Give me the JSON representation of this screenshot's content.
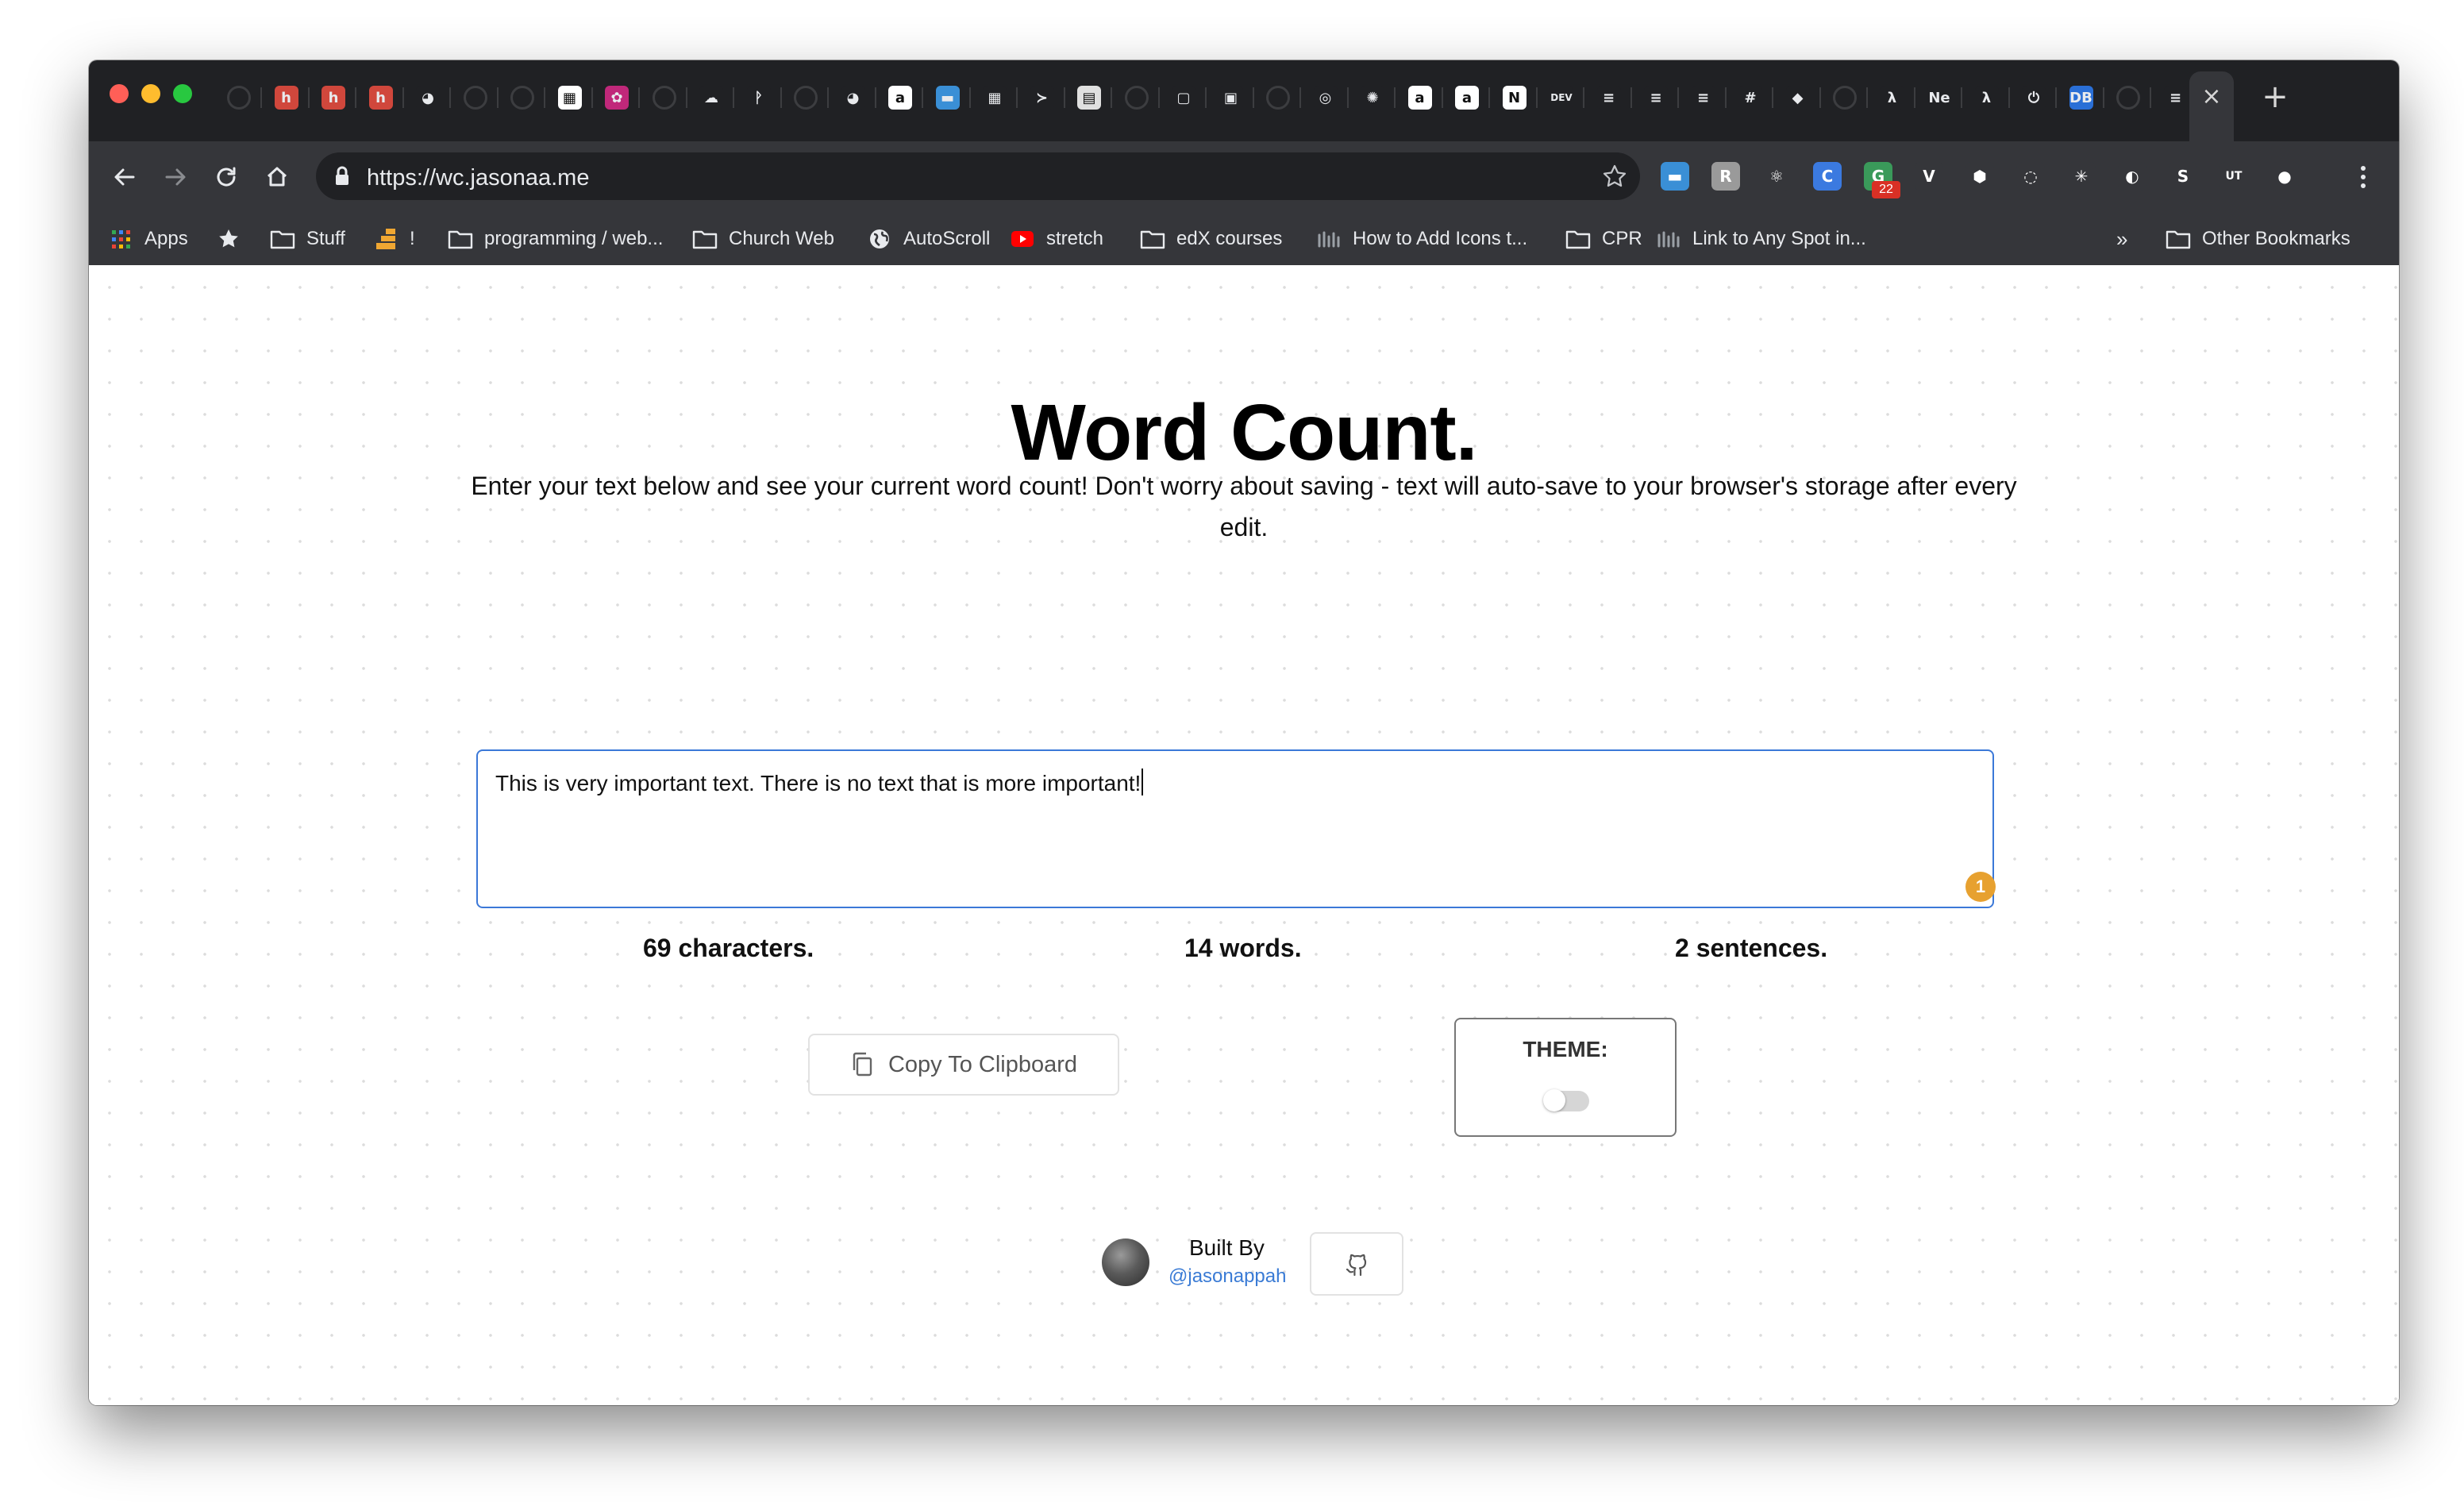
{
  "browser": {
    "url": "https://wc.jasonaa.me",
    "tab_favicons": [
      {
        "name": "github-icon",
        "glyph": "",
        "bg": "#202124"
      },
      {
        "name": "h-icon",
        "glyph": "h",
        "bg": "#d0473c"
      },
      {
        "name": "h-icon",
        "glyph": "h",
        "bg": "#d0473c"
      },
      {
        "name": "h-icon",
        "glyph": "h",
        "bg": "#d0473c"
      },
      {
        "name": "globe-icon",
        "glyph": "◕",
        "bg": "#202124"
      },
      {
        "name": "github-icon",
        "glyph": "",
        "bg": "#202124"
      },
      {
        "name": "github-icon",
        "glyph": "",
        "bg": "#202124"
      },
      {
        "name": "qr-icon",
        "glyph": "▦",
        "bg": "#ffffff"
      },
      {
        "name": "gear-pink-icon",
        "glyph": "✿",
        "bg": "#c0287a"
      },
      {
        "name": "github-icon",
        "glyph": "",
        "bg": "#202124"
      },
      {
        "name": "cloudflare-icon",
        "glyph": "☁",
        "bg": "#202124"
      },
      {
        "name": "leaf-icon",
        "glyph": "ᚹ",
        "bg": "#202124"
      },
      {
        "name": "github-icon",
        "glyph": "",
        "bg": "#202124"
      },
      {
        "name": "globe-icon",
        "glyph": "◕",
        "bg": "#202124"
      },
      {
        "name": "amazon-icon",
        "glyph": "a",
        "bg": "#ffffff"
      },
      {
        "name": "window-icon",
        "glyph": "▬",
        "bg": "#3a8fd6"
      },
      {
        "name": "microsoft-icon",
        "glyph": "▦",
        "bg": "#202124"
      },
      {
        "name": "vscode-icon",
        "glyph": "≻",
        "bg": "#202124"
      },
      {
        "name": "notes-icon",
        "glyph": "▤",
        "bg": "#e0e0e0"
      },
      {
        "name": "github-icon",
        "glyph": "",
        "bg": "#202124"
      },
      {
        "name": "square-icon",
        "glyph": "▢",
        "bg": "#202124"
      },
      {
        "name": "chip-icon",
        "glyph": "▣",
        "bg": "#202124"
      },
      {
        "name": "github-icon",
        "glyph": "",
        "bg": "#202124"
      },
      {
        "name": "circle-check-icon",
        "glyph": "◎",
        "bg": "#202124"
      },
      {
        "name": "openai-icon",
        "glyph": "✺",
        "bg": "#202124"
      },
      {
        "name": "amazon-icon",
        "glyph": "a",
        "bg": "#ffffff"
      },
      {
        "name": "amazon-icon",
        "glyph": "a",
        "bg": "#ffffff"
      },
      {
        "name": "notion-icon",
        "glyph": "N",
        "bg": "#ffffff"
      },
      {
        "name": "dev-icon",
        "glyph": "DEV",
        "bg": "#202124"
      },
      {
        "name": "stackoverflow-icon",
        "glyph": "≡",
        "bg": "#202124"
      },
      {
        "name": "stackoverflow-icon",
        "glyph": "≡",
        "bg": "#202124"
      },
      {
        "name": "stackoverflow-icon",
        "glyph": "≡",
        "bg": "#202124"
      },
      {
        "name": "slack-icon",
        "glyph": "#",
        "bg": "#202124"
      },
      {
        "name": "git-icon",
        "glyph": "◆",
        "bg": "#202124"
      },
      {
        "name": "github-icon",
        "glyph": "",
        "bg": "#202124"
      },
      {
        "name": "lambda-icon",
        "glyph": "λ",
        "bg": "#202124"
      },
      {
        "name": "ne-icon",
        "glyph": "Ne",
        "bg": "#202124"
      },
      {
        "name": "lambda-icon",
        "glyph": "λ",
        "bg": "#202124"
      },
      {
        "name": "power-icon",
        "glyph": "⏻",
        "bg": "#202124"
      },
      {
        "name": "dams-icon",
        "glyph": "DB",
        "bg": "#2a6fd6"
      },
      {
        "name": "github-icon",
        "glyph": "",
        "bg": "#202124"
      },
      {
        "name": "stackoverflow-icon",
        "glyph": "≡",
        "bg": "#202124"
      }
    ],
    "extensions": [
      {
        "name": "window-icon",
        "glyph": "▬",
        "bg": "#3a8fd6"
      },
      {
        "name": "r-icon",
        "glyph": "R",
        "bg": "#9a9a9a"
      },
      {
        "name": "react-icon",
        "glyph": "⚛",
        "bg": "#35363a"
      },
      {
        "name": "c-icon",
        "glyph": "C",
        "bg": "#3b7ae0"
      },
      {
        "name": "g-icon",
        "glyph": "G",
        "bg": "#3a9a5a",
        "badge": "22"
      },
      {
        "name": "vue-icon",
        "glyph": "V",
        "bg": "#35363a"
      },
      {
        "name": "cube-icon",
        "glyph": "⬢",
        "bg": "#35363a"
      },
      {
        "name": "search-icon",
        "glyph": "◌",
        "bg": "#35363a"
      },
      {
        "name": "sparkle-icon",
        "glyph": "✳",
        "bg": "#35363a"
      },
      {
        "name": "toggle-ext-icon",
        "glyph": "◐",
        "bg": "#35363a"
      },
      {
        "name": "s-icon",
        "glyph": "S",
        "bg": "#35363a"
      },
      {
        "name": "ut-icon",
        "glyph": "UT",
        "bg": "#35363a"
      },
      {
        "name": "profile-avatar-icon",
        "glyph": "●",
        "bg": "#35363a"
      }
    ],
    "bookmarks": [
      {
        "label": "Apps",
        "icon": "apps-grid-icon"
      },
      {
        "label": "",
        "icon": "star-icon"
      },
      {
        "label": "Stuff",
        "icon": "folder-icon"
      },
      {
        "label": "!",
        "icon": "ladder-icon"
      },
      {
        "label": "programming / web...",
        "icon": "folder-icon"
      },
      {
        "label": "Church Web",
        "icon": "folder-icon"
      },
      {
        "label": "AutoScroll",
        "icon": "globe-icon"
      },
      {
        "label": "stretch",
        "icon": "youtube-icon"
      },
      {
        "label": "edX courses",
        "icon": "folder-icon"
      },
      {
        "label": "How to Add Icons t...",
        "icon": "wave-icon"
      },
      {
        "label": "CPR",
        "icon": "folder-icon"
      },
      {
        "label": "Link to Any Spot in...",
        "icon": "wave-icon"
      }
    ],
    "overflow_label": "»",
    "other_bookmarks": "Other Bookmarks"
  },
  "page": {
    "title": "Word Count.",
    "subtitle": "Enter your text below and see your current word count! Don't worry about saving - text will auto-save to your browser's storage after every edit.",
    "text": "This is very important text. There is no text that is more important!",
    "grammar_badge": "1",
    "stats": {
      "characters": "69 characters.",
      "words": "14 words.",
      "sentences": "2 sentences."
    },
    "copy_button": "Copy To Clipboard",
    "theme_label": "THEME:",
    "theme_dark": false,
    "built_by": "Built By",
    "handle": "@jasonappah"
  },
  "colors": {
    "accent_blue": "#3b78d8",
    "link_blue": "#3a7bd5",
    "badge_orange": "#e7a130"
  }
}
